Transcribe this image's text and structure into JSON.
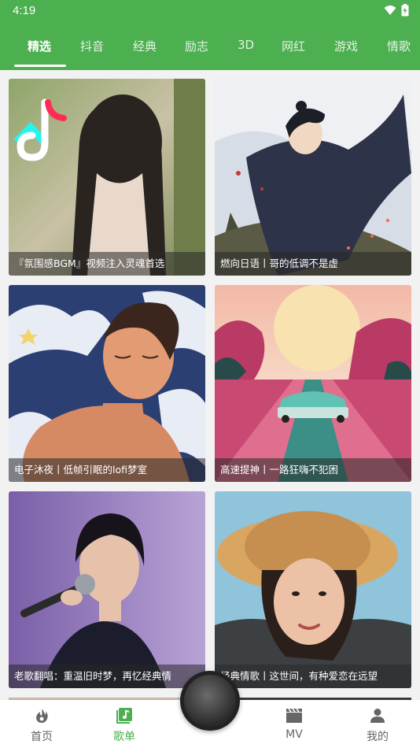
{
  "status": {
    "time": "4:19"
  },
  "tabs": [
    {
      "label": "精选",
      "active": true
    },
    {
      "label": "抖音"
    },
    {
      "label": "经典"
    },
    {
      "label": "励志"
    },
    {
      "label": "3D"
    },
    {
      "label": "网红"
    },
    {
      "label": "游戏"
    },
    {
      "label": "情歌"
    }
  ],
  "cards": [
    {
      "title": "『氛围感BGM』视频注入灵魂首选"
    },
    {
      "title": "燃向日语丨哥的低调不是虚"
    },
    {
      "title": "电子沐夜丨低帧引眠的lofi梦室"
    },
    {
      "title": "高速提神丨一路狂嗨不犯困"
    },
    {
      "title": "老歌翻唱：重温旧时梦，再忆经典情"
    },
    {
      "title": "经典情歌丨这世间，有种爱恋在远望"
    }
  ],
  "nav": [
    {
      "label": "首页",
      "icon": "flame-icon"
    },
    {
      "label": "歌单",
      "icon": "music-note-icon",
      "active": true
    },
    {
      "label": "MV",
      "icon": "clapperboard-icon"
    },
    {
      "label": "我的",
      "icon": "person-icon"
    }
  ],
  "colors": {
    "accent": "#4caf50"
  }
}
